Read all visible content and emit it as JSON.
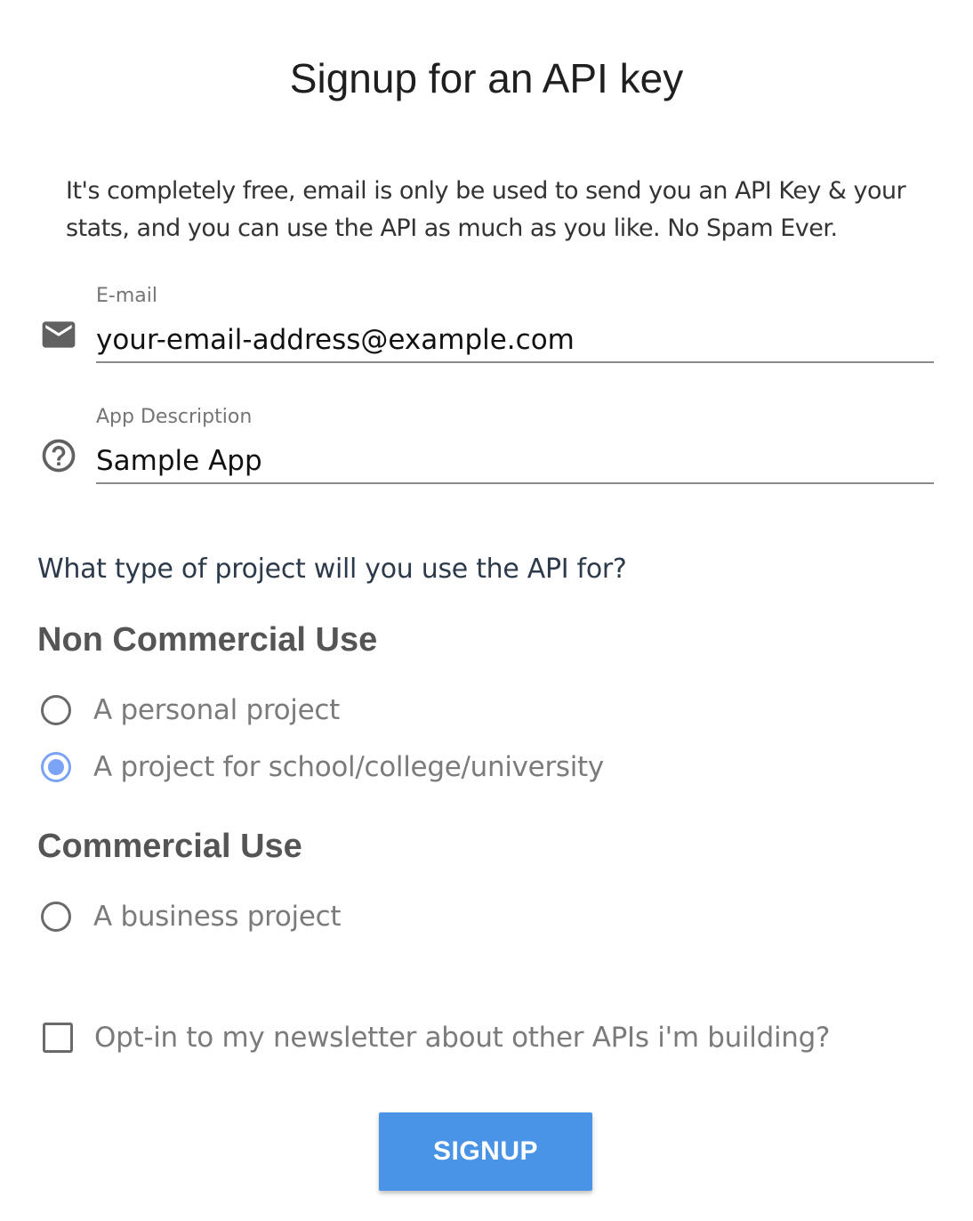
{
  "page": {
    "title": "Signup for an API key",
    "intro": "It's completely free, email is only be used to send you an API Key & your stats, and you can use the API as much as you like. No Spam Ever."
  },
  "form": {
    "email": {
      "label": "E-mail",
      "value": "your-email-address@example.com",
      "icon": "envelope-icon"
    },
    "app_description": {
      "label": "App Description",
      "value": "Sample App",
      "icon": "help-circle-icon"
    },
    "project_question": "What type of project will you use the API for?",
    "non_commercial": {
      "heading": "Non Commercial Use",
      "options": [
        {
          "label": "A personal project",
          "checked": false
        },
        {
          "label": "A project for school/college/university",
          "checked": true
        }
      ]
    },
    "commercial": {
      "heading": "Commercial Use",
      "options": [
        {
          "label": "A business project",
          "checked": false
        }
      ]
    },
    "newsletter": {
      "label": "Opt-in to my newsletter about other APIs i'm building?",
      "checked": false
    },
    "submit_label": "SIGNUP"
  },
  "colors": {
    "accent": "#4a94e8",
    "radio_selected": "#7aa3f5"
  }
}
